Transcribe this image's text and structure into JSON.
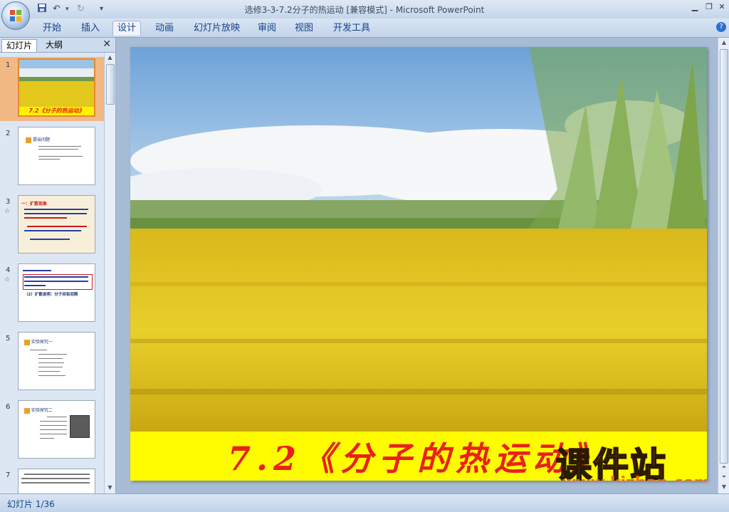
{
  "window": {
    "title": "选修3-3-7.2分子的热运动 [兼容模式] - Microsoft PowerPoint",
    "controls": [
      "minimize-icon",
      "restore-icon",
      "close-icon"
    ]
  },
  "quick_access": [
    "save-icon",
    "undo-icon",
    "redo-icon",
    "customize-icon"
  ],
  "ribbon": {
    "tabs": [
      "开始",
      "插入",
      "设计",
      "动画",
      "幻灯片放映",
      "审阅",
      "视图",
      "开发工具"
    ],
    "active_tab": "设计"
  },
  "panel": {
    "tabs": [
      "幻灯片",
      "大纲"
    ],
    "active_tab": "幻灯片",
    "slides": [
      {
        "num": "1",
        "title": "7.2《分子的热运动》",
        "selected": true
      },
      {
        "num": "2",
        "title": "提出问题"
      },
      {
        "num": "3",
        "title": "一：扩散现象",
        "anim": "☆"
      },
      {
        "num": "4",
        "title": "（2）扩散说明：分子间有间隙",
        "anim": "☆"
      },
      {
        "num": "5",
        "title": "实验探究一"
      },
      {
        "num": "6",
        "title": "实验探究二"
      },
      {
        "num": "7",
        "title": ""
      }
    ]
  },
  "slide": {
    "title": "7.2《分子的热运动》",
    "watermark": "课件站",
    "watermark_url": "www.kjzhan.com"
  },
  "status": {
    "text": "幻灯片 1/36"
  },
  "colors": {
    "title_band": "#fffb00",
    "title_text": "#e8211a",
    "selection": "#f2b985"
  }
}
